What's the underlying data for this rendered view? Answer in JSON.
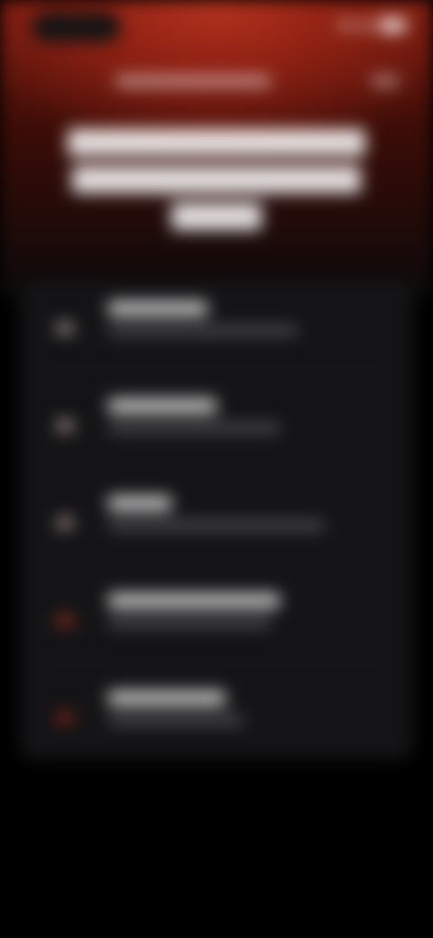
{
  "status_bar": {
    "time": "",
    "icons": [
      "signal-icon",
      "wifi-icon",
      "battery-icon"
    ]
  },
  "nav": {
    "title": "",
    "action_label": ""
  },
  "headline": "",
  "items": [
    {
      "title": "",
      "subtitle": "",
      "icon": "chevron-up-icon",
      "accent": "#f0d8d4"
    },
    {
      "title": "",
      "subtitle": "",
      "icon": "chevron-up-icon",
      "accent": "#f0d2cc"
    },
    {
      "title": "",
      "subtitle": "",
      "icon": "chevron-up-icon",
      "accent": "#e8c2ba"
    },
    {
      "title": "",
      "subtitle": "",
      "icon": "chevron-up-icon",
      "accent": "#d4371f"
    },
    {
      "title": "",
      "subtitle": "",
      "icon": "chevron-up-icon",
      "accent": "#c72a18"
    }
  ],
  "colors": {
    "accent": "#b5331f",
    "background": "#000000",
    "panel": "#141416"
  }
}
